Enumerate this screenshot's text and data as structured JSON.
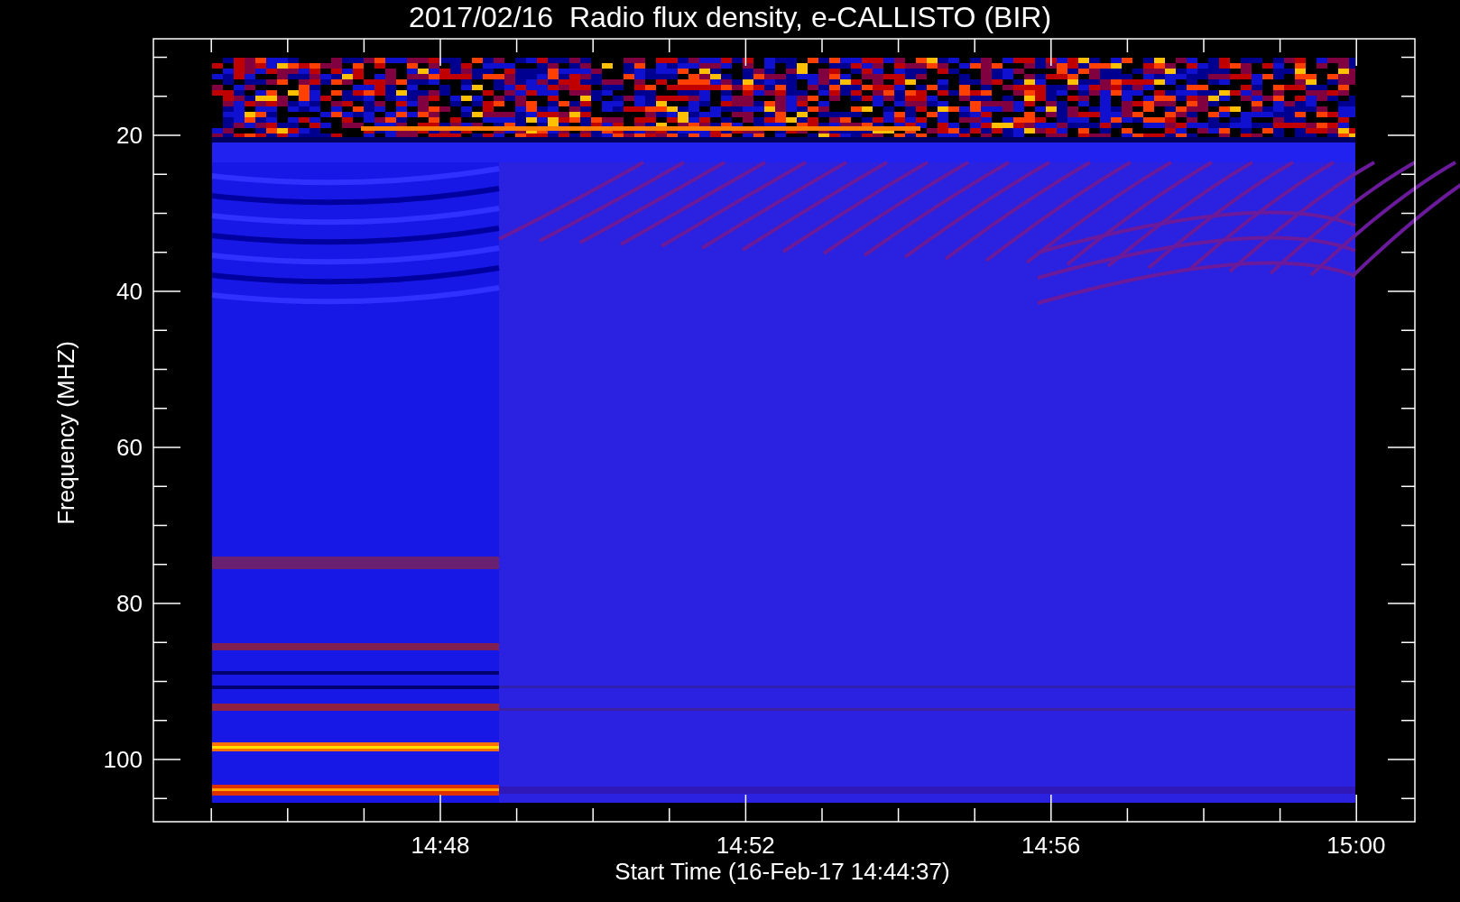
{
  "title": "2017/02/16  Radio flux density, e-CALLISTO (BIR)",
  "y_axis": {
    "label": "Frequency (MHZ)",
    "ticks": [
      "20",
      "40",
      "60",
      "80",
      "100"
    ]
  },
  "x_axis": {
    "label": "Start Time (16-Feb-17 14:44:37)",
    "ticks": [
      "14:48",
      "14:52",
      "14:56",
      "15:00"
    ]
  }
}
